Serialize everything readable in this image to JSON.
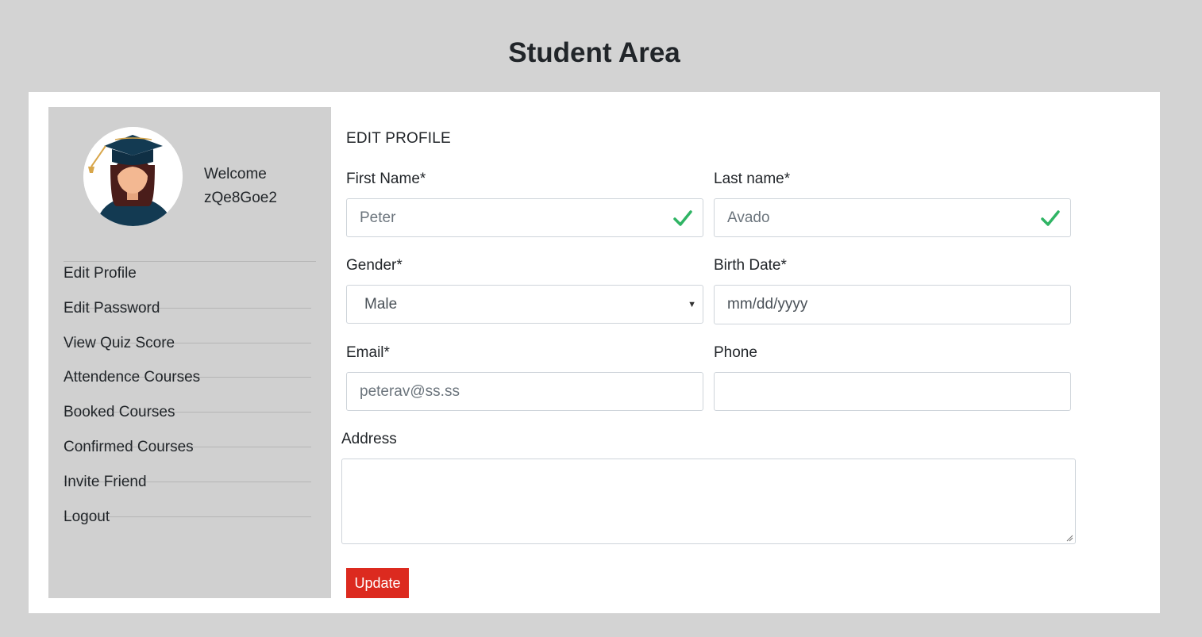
{
  "page": {
    "title": "Student Area"
  },
  "sidebar": {
    "welcome_label": "Welcome",
    "username": "zQe8Goe2",
    "items": [
      {
        "label": "Edit Profile"
      },
      {
        "label": "Edit Password"
      },
      {
        "label": "View Quiz Score"
      },
      {
        "label": "Attendence Courses"
      },
      {
        "label": "Booked Courses"
      },
      {
        "label": "Confirmed Courses"
      },
      {
        "label": "Invite Friend"
      },
      {
        "label": "Logout"
      }
    ]
  },
  "form": {
    "section_title": "EDIT PROFILE",
    "first_name": {
      "label": "First Name*",
      "placeholder": "Peter",
      "value": ""
    },
    "last_name": {
      "label": "Last name*",
      "placeholder": "Avado",
      "value": ""
    },
    "gender": {
      "label": "Gender*",
      "selected": "Male"
    },
    "birth_date": {
      "label": "Birth Date*",
      "placeholder": "mm/dd/yyyy"
    },
    "email": {
      "label": "Email*",
      "placeholder": "peterav@ss.ss"
    },
    "phone": {
      "label": "Phone",
      "value": ""
    },
    "address": {
      "label": "Address",
      "value": ""
    },
    "submit_label": "Update"
  },
  "colors": {
    "background": "#d3d3d3",
    "sidebar": "#d0d0d0",
    "accent_button": "#dc2a1f",
    "valid_check": "#2fb464"
  },
  "icons": {
    "valid": "check-icon",
    "select": "caret-down-icon",
    "avatar": "graduate-avatar-icon"
  }
}
